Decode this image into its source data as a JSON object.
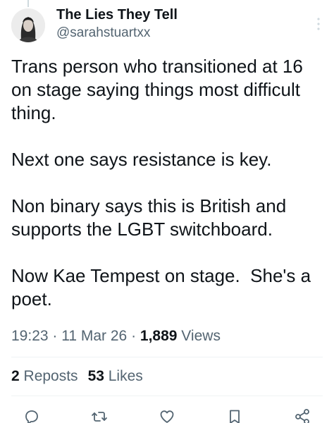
{
  "author": {
    "display_name": "The Lies They Tell",
    "handle": "@sarahstuartxx"
  },
  "tweet": {
    "text": "Trans person who transitioned at 16\non stage saying things most difficult\nthing.\n\nNext one says resistance is key.\n\nNon binary says this is British and\nsupports the LGBT switchboard.\n\nNow Kae Tempest on stage.  She's a\npoet."
  },
  "meta": {
    "time": "19:23",
    "separator": " · ",
    "date": "11 Mar 26",
    "views_count": "1,889",
    "views_label": " Views"
  },
  "stats": {
    "reposts_count": "2",
    "reposts_label": " Reposts",
    "likes_count": "53",
    "likes_label": " Likes"
  },
  "actions": [
    {
      "name": "reply",
      "icon": "reply-icon"
    },
    {
      "name": "repost",
      "icon": "repost-icon"
    },
    {
      "name": "like",
      "icon": "heart-icon"
    },
    {
      "name": "bookmark",
      "icon": "bookmark-icon"
    },
    {
      "name": "share",
      "icon": "share-icon"
    }
  ],
  "colors": {
    "text_primary": "#0f1419",
    "text_secondary": "#536471",
    "divider": "#eff3f4",
    "icon": "#536471"
  }
}
